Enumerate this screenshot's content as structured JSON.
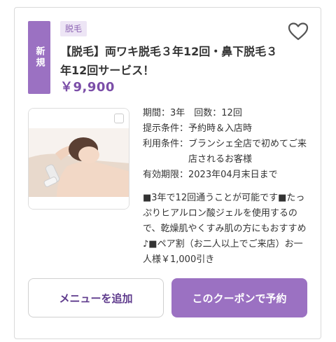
{
  "coupon": {
    "new_badge": "新規",
    "category": "脱毛",
    "title": "【脱毛】両ワキ脱毛３年12回・鼻下脱毛３年12回サービス！",
    "price": "￥9,900",
    "favorite_icon": "heart-outline-icon",
    "image_alt": "施術中の女性",
    "details": [
      {
        "label": "期間：",
        "value": "3年　回数：12回"
      },
      {
        "label": "提示条件：",
        "value": "予約時＆入店時"
      },
      {
        "label": "利用条件：",
        "value": "ブランシェ全店で初めてご来店されるお客様"
      },
      {
        "label": "有効期限：",
        "value": "2023年04月末日まで"
      }
    ],
    "description": "■3年で12回通うことが可能です■たっぷりヒアルロン酸ジェルを使用するので、乾燥肌やくすみ肌の方にもおすすめ♪■ペア割（お二人以上でご来店）お一人様￥1,000引き"
  },
  "actions": {
    "add_menu": "メニューを追加",
    "reserve": "このクーポンで予約"
  },
  "colors": {
    "accent": "#9b71c2",
    "price": "#7b4ea8",
    "tag_bg": "#ede5f5"
  }
}
